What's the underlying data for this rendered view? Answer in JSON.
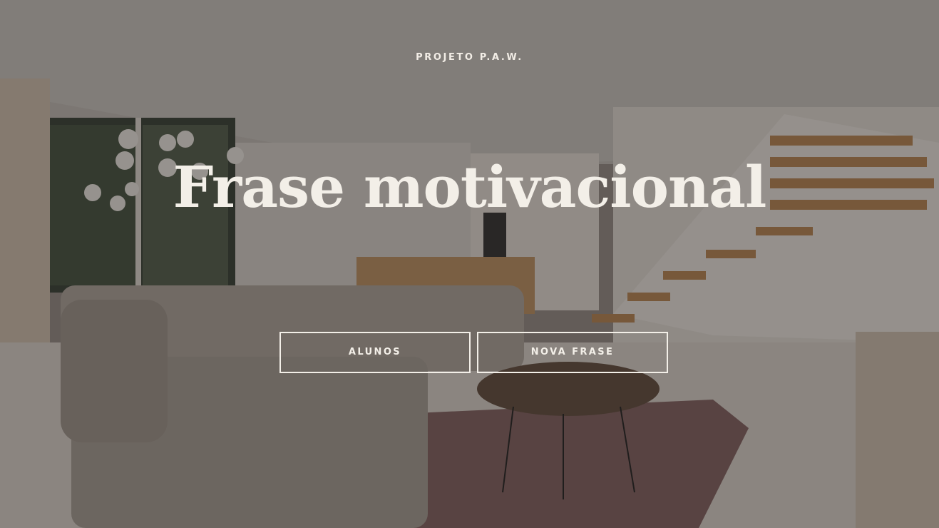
{
  "hero": {
    "eyebrow": "PROJETO P.A.W.",
    "headline": "Frase motivacional",
    "background_image": "living-room-interior-photo"
  },
  "buttons": {
    "alunos_label": "ALUNOS",
    "nova_frase_label": "NOVA FRASE"
  },
  "colors": {
    "text": "#f3efe8",
    "overlay": "rgba(40,36,34,0.42)"
  }
}
